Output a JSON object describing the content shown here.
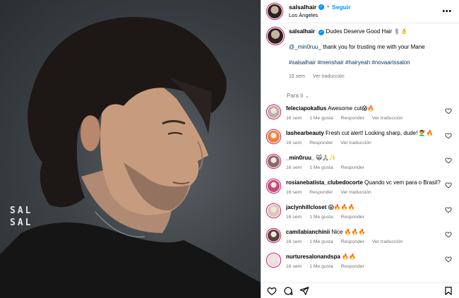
{
  "photo": {
    "watermark_line1": "SAL",
    "watermark_line2": "SAL"
  },
  "header": {
    "username": "salsalhair",
    "verified_mark": "✓",
    "separator": "•",
    "follow_label": "Seguir",
    "location": "Los Ángeles",
    "more_label": "•••"
  },
  "caption": {
    "username": "salsalhair",
    "title": "Dudes Deserve Good Hair 💈👌",
    "mention": "@_min0ruu_",
    "thanks": " thank you for trusting me with your Mane",
    "hashtags": "#salsalhair #menshair #hairyeah #novaartssalon",
    "time": "16 sem",
    "translate": "Ver traducción"
  },
  "for_you": {
    "label": "Para ti",
    "chevron": "⌄"
  },
  "comments": [
    {
      "user": "feleciapokallus",
      "text": "Awesome cut😱🔥",
      "time": "16 sem",
      "likes": "1 Me gusta",
      "reply": "Responder",
      "translate": "Ver traducción",
      "avatar_color": "#b9b2a8"
    },
    {
      "user": "lashearbeauty",
      "text": "Fresh cut alert! Looking sharp, dude! 💇‍♂️🔥",
      "time": "16 sem",
      "likes": "",
      "reply": "Responder",
      "translate": "Ver traducción",
      "avatar_color": "#e8873a"
    },
    {
      "user": "_min0ruu_",
      "text": "🙀🙏🏼✨",
      "time": "16 sem",
      "likes": "1 Me gusta",
      "reply": "Responder",
      "translate": "",
      "avatar_color": "#8a6a66"
    },
    {
      "user": "rosianebatista_clubedocorte",
      "text": "Quando vc vem para o Brasil?",
      "time": "16 sem",
      "likes": "",
      "reply": "Responder",
      "translate": "Ver traducción",
      "avatar_color": "#c24a7a"
    },
    {
      "user": "jaclynhillcloset",
      "text": "😱🔥🔥🔥",
      "time": "16 sem",
      "likes": "1 Me gusta",
      "reply": "Responder",
      "translate": "",
      "avatar_color": "#d9c9b8"
    },
    {
      "user": "camilabianchinii",
      "text": "Nice 🔥🔥🔥",
      "time": "16 sem",
      "likes": "1 Me gusta",
      "reply": "Responder",
      "translate": "Ver traducción",
      "avatar_color": "#5a4236"
    },
    {
      "user": "nurturesalonandspa",
      "text": "🔥🔥",
      "time": "16 sem",
      "likes": "1 Me gusta",
      "reply": "Responder",
      "translate": "",
      "avatar_color": "#e9dfe6"
    }
  ],
  "icons": {
    "like": "heart-icon",
    "comment": "comment-icon",
    "share": "share-icon",
    "save": "bookmark-icon"
  },
  "colors": {
    "accent": "#0095f6",
    "link": "#00376b",
    "secondary_text": "#737373",
    "story_ring": "#d62976"
  }
}
